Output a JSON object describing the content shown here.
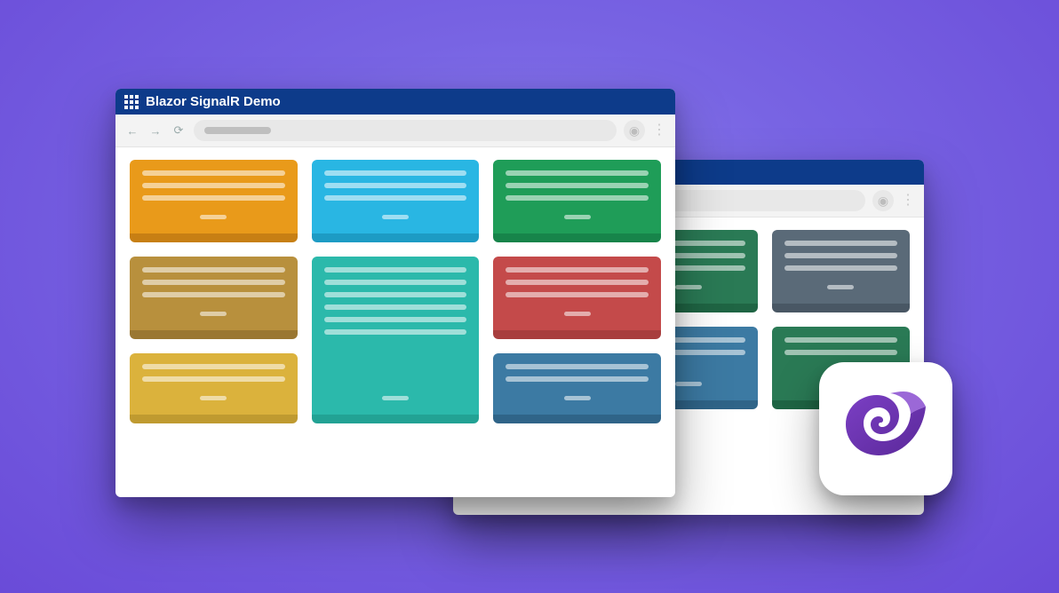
{
  "front_window": {
    "title": "Blazor SignalR Demo",
    "cards": [
      {
        "color": "orange",
        "lines": 3
      },
      {
        "color": "cyan",
        "lines": 3
      },
      {
        "color": "green",
        "lines": 3
      },
      {
        "color": "olive",
        "lines": 3
      },
      {
        "color": "teal",
        "lines": 6,
        "tall": true
      },
      {
        "color": "red",
        "lines": 3
      },
      {
        "color": "yellow",
        "lines": 2
      },
      {
        "color": "steel",
        "lines": 2
      }
    ]
  },
  "back_window": {
    "cards": [
      {
        "color": "cyan",
        "lines": 3
      },
      {
        "color": "dgreen",
        "lines": 3
      },
      {
        "color": "dgrey",
        "lines": 3
      },
      {
        "color": "red",
        "lines": 3
      },
      {
        "color": "steel",
        "lines": 2
      },
      {
        "color": "dgreen",
        "lines": 2
      }
    ]
  },
  "badge": {
    "name": "blazor-logo"
  },
  "colors": {
    "orange": "#e99a1a",
    "cyan": "#29b6e3",
    "green": "#1f9d58",
    "olive": "#b8903d",
    "teal": "#2bb9ab",
    "red": "#c44a4a",
    "yellow": "#dbb23c",
    "steel": "#3c7aa3",
    "dgreen": "#2a7a55",
    "dgrey": "#5a6a78"
  }
}
